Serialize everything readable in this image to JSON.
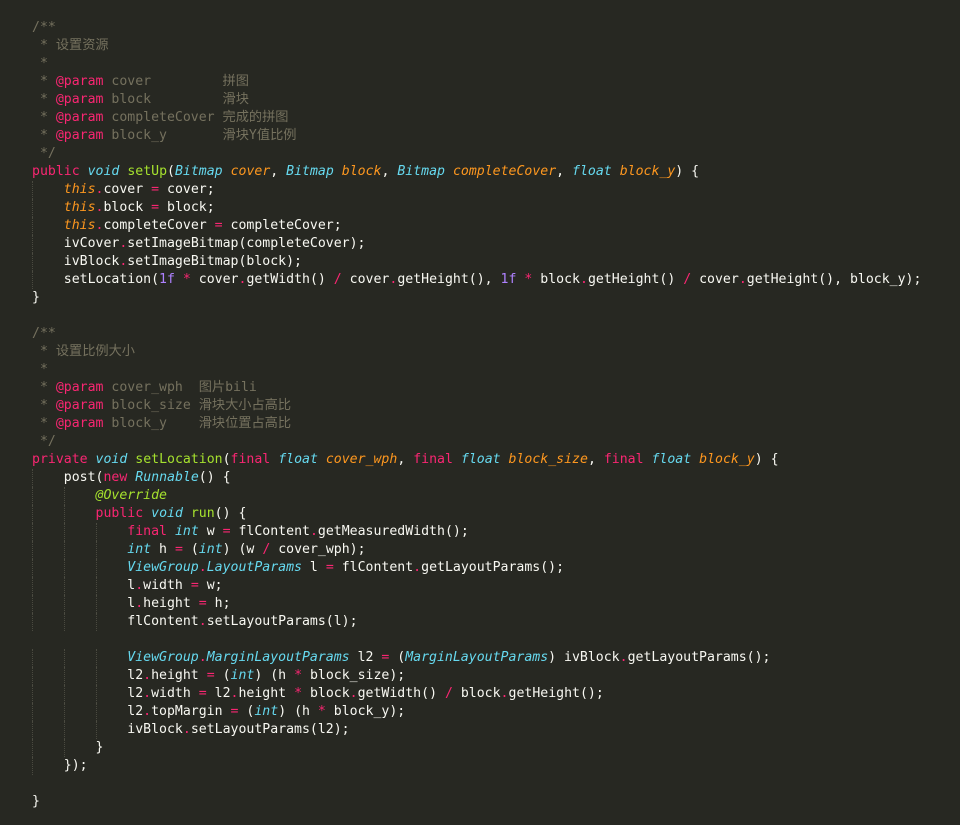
{
  "editor": {
    "theme_colors": {
      "background": "#272822",
      "comment": "#75715e",
      "keyword": "#f92672",
      "type": "#66d9ef",
      "function": "#a6e22e",
      "parameter": "#fd971f",
      "number": "#ae81ff",
      "text": "#f8f8f2"
    },
    "lines": [
      [
        {
          "t": "/**",
          "c": "comment"
        }
      ],
      [
        {
          "t": " * 设置资源",
          "c": "comment"
        }
      ],
      [
        {
          "t": " *",
          "c": "comment"
        }
      ],
      [
        {
          "t": " * ",
          "c": "comment"
        },
        {
          "t": "@param",
          "c": "tag"
        },
        {
          "t": " cover         拼图",
          "c": "comment"
        }
      ],
      [
        {
          "t": " * ",
          "c": "comment"
        },
        {
          "t": "@param",
          "c": "tag"
        },
        {
          "t": " block         滑块",
          "c": "comment"
        }
      ],
      [
        {
          "t": " * ",
          "c": "comment"
        },
        {
          "t": "@param",
          "c": "tag"
        },
        {
          "t": " completeCover 完成的拼图",
          "c": "comment"
        }
      ],
      [
        {
          "t": " * ",
          "c": "comment"
        },
        {
          "t": "@param",
          "c": "tag"
        },
        {
          "t": " block_y       滑块Y值比例",
          "c": "comment"
        }
      ],
      [
        {
          "t": " */",
          "c": "comment"
        }
      ],
      [
        {
          "t": "public",
          "c": "kw"
        },
        {
          "t": " ",
          "c": "plain"
        },
        {
          "t": "void",
          "c": "type"
        },
        {
          "t": " ",
          "c": "plain"
        },
        {
          "t": "setUp",
          "c": "fn"
        },
        {
          "t": "(",
          "c": "plain"
        },
        {
          "t": "Bitmap",
          "c": "type"
        },
        {
          "t": " ",
          "c": "plain"
        },
        {
          "t": "cover",
          "c": "param"
        },
        {
          "t": ", ",
          "c": "plain"
        },
        {
          "t": "Bitmap",
          "c": "type"
        },
        {
          "t": " ",
          "c": "plain"
        },
        {
          "t": "block",
          "c": "param"
        },
        {
          "t": ", ",
          "c": "plain"
        },
        {
          "t": "Bitmap",
          "c": "type"
        },
        {
          "t": " ",
          "c": "plain"
        },
        {
          "t": "completeCover",
          "c": "param"
        },
        {
          "t": ", ",
          "c": "plain"
        },
        {
          "t": "float",
          "c": "type"
        },
        {
          "t": " ",
          "c": "plain"
        },
        {
          "t": "block_y",
          "c": "param"
        },
        {
          "t": ") {",
          "c": "plain"
        }
      ],
      [
        {
          "t": "    ",
          "c": "plain"
        },
        {
          "t": "this",
          "c": "this"
        },
        {
          "t": ".",
          "c": "op"
        },
        {
          "t": "cover ",
          "c": "plain"
        },
        {
          "t": "=",
          "c": "op"
        },
        {
          "t": " cover;",
          "c": "plain"
        }
      ],
      [
        {
          "t": "    ",
          "c": "plain"
        },
        {
          "t": "this",
          "c": "this"
        },
        {
          "t": ".",
          "c": "op"
        },
        {
          "t": "block ",
          "c": "plain"
        },
        {
          "t": "=",
          "c": "op"
        },
        {
          "t": " block;",
          "c": "plain"
        }
      ],
      [
        {
          "t": "    ",
          "c": "plain"
        },
        {
          "t": "this",
          "c": "this"
        },
        {
          "t": ".",
          "c": "op"
        },
        {
          "t": "completeCover ",
          "c": "plain"
        },
        {
          "t": "=",
          "c": "op"
        },
        {
          "t": " completeCover;",
          "c": "plain"
        }
      ],
      [
        {
          "t": "    ivCover",
          "c": "plain"
        },
        {
          "t": ".",
          "c": "op"
        },
        {
          "t": "setImageBitmap(completeCover);",
          "c": "plain"
        }
      ],
      [
        {
          "t": "    ivBlock",
          "c": "plain"
        },
        {
          "t": ".",
          "c": "op"
        },
        {
          "t": "setImageBitmap(block);",
          "c": "plain"
        }
      ],
      [
        {
          "t": "    setLocation(",
          "c": "plain"
        },
        {
          "t": "1f",
          "c": "num"
        },
        {
          "t": " ",
          "c": "plain"
        },
        {
          "t": "*",
          "c": "op"
        },
        {
          "t": " cover",
          "c": "plain"
        },
        {
          "t": ".",
          "c": "op"
        },
        {
          "t": "getWidth() ",
          "c": "plain"
        },
        {
          "t": "/",
          "c": "op"
        },
        {
          "t": " cover",
          "c": "plain"
        },
        {
          "t": ".",
          "c": "op"
        },
        {
          "t": "getHeight(), ",
          "c": "plain"
        },
        {
          "t": "1f",
          "c": "num"
        },
        {
          "t": " ",
          "c": "plain"
        },
        {
          "t": "*",
          "c": "op"
        },
        {
          "t": " block",
          "c": "plain"
        },
        {
          "t": ".",
          "c": "op"
        },
        {
          "t": "getHeight() ",
          "c": "plain"
        },
        {
          "t": "/",
          "c": "op"
        },
        {
          "t": " cover",
          "c": "plain"
        },
        {
          "t": ".",
          "c": "op"
        },
        {
          "t": "getHeight(), block_y);",
          "c": "plain"
        }
      ],
      [
        {
          "t": "}",
          "c": "plain"
        }
      ],
      [],
      [
        {
          "t": "/**",
          "c": "comment"
        }
      ],
      [
        {
          "t": " * 设置比例大小",
          "c": "comment"
        }
      ],
      [
        {
          "t": " *",
          "c": "comment"
        }
      ],
      [
        {
          "t": " * ",
          "c": "comment"
        },
        {
          "t": "@param",
          "c": "tag"
        },
        {
          "t": " cover_wph  图片bili",
          "c": "comment"
        }
      ],
      [
        {
          "t": " * ",
          "c": "comment"
        },
        {
          "t": "@param",
          "c": "tag"
        },
        {
          "t": " block_size 滑块大小占高比",
          "c": "comment"
        }
      ],
      [
        {
          "t": " * ",
          "c": "comment"
        },
        {
          "t": "@param",
          "c": "tag"
        },
        {
          "t": " block_y    滑块位置占高比",
          "c": "comment"
        }
      ],
      [
        {
          "t": " */",
          "c": "comment"
        }
      ],
      [
        {
          "t": "private",
          "c": "kw"
        },
        {
          "t": " ",
          "c": "plain"
        },
        {
          "t": "void",
          "c": "type"
        },
        {
          "t": " ",
          "c": "plain"
        },
        {
          "t": "setLocation",
          "c": "fn"
        },
        {
          "t": "(",
          "c": "plain"
        },
        {
          "t": "final",
          "c": "kw"
        },
        {
          "t": " ",
          "c": "plain"
        },
        {
          "t": "float",
          "c": "type"
        },
        {
          "t": " ",
          "c": "plain"
        },
        {
          "t": "cover_wph",
          "c": "param"
        },
        {
          "t": ", ",
          "c": "plain"
        },
        {
          "t": "final",
          "c": "kw"
        },
        {
          "t": " ",
          "c": "plain"
        },
        {
          "t": "float",
          "c": "type"
        },
        {
          "t": " ",
          "c": "plain"
        },
        {
          "t": "block_size",
          "c": "param"
        },
        {
          "t": ", ",
          "c": "plain"
        },
        {
          "t": "final",
          "c": "kw"
        },
        {
          "t": " ",
          "c": "plain"
        },
        {
          "t": "float",
          "c": "type"
        },
        {
          "t": " ",
          "c": "plain"
        },
        {
          "t": "block_y",
          "c": "param"
        },
        {
          "t": ") {",
          "c": "plain"
        }
      ],
      [
        {
          "t": "    post(",
          "c": "plain"
        },
        {
          "t": "new",
          "c": "kw"
        },
        {
          "t": " ",
          "c": "plain"
        },
        {
          "t": "Runnable",
          "c": "type"
        },
        {
          "t": "() {",
          "c": "plain"
        }
      ],
      [
        {
          "t": "        ",
          "c": "plain"
        },
        {
          "t": "@Override",
          "c": "annot"
        }
      ],
      [
        {
          "t": "        ",
          "c": "plain"
        },
        {
          "t": "public",
          "c": "kw"
        },
        {
          "t": " ",
          "c": "plain"
        },
        {
          "t": "void",
          "c": "type"
        },
        {
          "t": " ",
          "c": "plain"
        },
        {
          "t": "run",
          "c": "fn"
        },
        {
          "t": "() {",
          "c": "plain"
        }
      ],
      [
        {
          "t": "            ",
          "c": "plain"
        },
        {
          "t": "final",
          "c": "kw"
        },
        {
          "t": " ",
          "c": "plain"
        },
        {
          "t": "int",
          "c": "prim"
        },
        {
          "t": " w ",
          "c": "plain"
        },
        {
          "t": "=",
          "c": "op"
        },
        {
          "t": " flContent",
          "c": "plain"
        },
        {
          "t": ".",
          "c": "op"
        },
        {
          "t": "getMeasuredWidth();",
          "c": "plain"
        }
      ],
      [
        {
          "t": "            ",
          "c": "plain"
        },
        {
          "t": "int",
          "c": "prim"
        },
        {
          "t": " h ",
          "c": "plain"
        },
        {
          "t": "=",
          "c": "op"
        },
        {
          "t": " (",
          "c": "plain"
        },
        {
          "t": "int",
          "c": "prim"
        },
        {
          "t": ") (w ",
          "c": "plain"
        },
        {
          "t": "/",
          "c": "op"
        },
        {
          "t": " cover_wph);",
          "c": "plain"
        }
      ],
      [
        {
          "t": "            ",
          "c": "plain"
        },
        {
          "t": "ViewGroup",
          "c": "type"
        },
        {
          "t": ".",
          "c": "op"
        },
        {
          "t": "LayoutParams",
          "c": "type"
        },
        {
          "t": " l ",
          "c": "plain"
        },
        {
          "t": "=",
          "c": "op"
        },
        {
          "t": " flContent",
          "c": "plain"
        },
        {
          "t": ".",
          "c": "op"
        },
        {
          "t": "getLayoutParams();",
          "c": "plain"
        }
      ],
      [
        {
          "t": "            l",
          "c": "plain"
        },
        {
          "t": ".",
          "c": "op"
        },
        {
          "t": "width ",
          "c": "plain"
        },
        {
          "t": "=",
          "c": "op"
        },
        {
          "t": " w;",
          "c": "plain"
        }
      ],
      [
        {
          "t": "            l",
          "c": "plain"
        },
        {
          "t": ".",
          "c": "op"
        },
        {
          "t": "height ",
          "c": "plain"
        },
        {
          "t": "=",
          "c": "op"
        },
        {
          "t": " h;",
          "c": "plain"
        }
      ],
      [
        {
          "t": "            flContent",
          "c": "plain"
        },
        {
          "t": ".",
          "c": "op"
        },
        {
          "t": "setLayoutParams(l);",
          "c": "plain"
        }
      ],
      [],
      [
        {
          "t": "            ",
          "c": "plain"
        },
        {
          "t": "ViewGroup",
          "c": "type"
        },
        {
          "t": ".",
          "c": "op"
        },
        {
          "t": "MarginLayoutParams",
          "c": "type"
        },
        {
          "t": " l2 ",
          "c": "plain"
        },
        {
          "t": "=",
          "c": "op"
        },
        {
          "t": " (",
          "c": "plain"
        },
        {
          "t": "MarginLayoutParams",
          "c": "type"
        },
        {
          "t": ") ivBlock",
          "c": "plain"
        },
        {
          "t": ".",
          "c": "op"
        },
        {
          "t": "getLayoutParams();",
          "c": "plain"
        }
      ],
      [
        {
          "t": "            l2",
          "c": "plain"
        },
        {
          "t": ".",
          "c": "op"
        },
        {
          "t": "height ",
          "c": "plain"
        },
        {
          "t": "=",
          "c": "op"
        },
        {
          "t": " (",
          "c": "plain"
        },
        {
          "t": "int",
          "c": "prim"
        },
        {
          "t": ") (h ",
          "c": "plain"
        },
        {
          "t": "*",
          "c": "op"
        },
        {
          "t": " block_size);",
          "c": "plain"
        }
      ],
      [
        {
          "t": "            l2",
          "c": "plain"
        },
        {
          "t": ".",
          "c": "op"
        },
        {
          "t": "width ",
          "c": "plain"
        },
        {
          "t": "=",
          "c": "op"
        },
        {
          "t": " l2",
          "c": "plain"
        },
        {
          "t": ".",
          "c": "op"
        },
        {
          "t": "height ",
          "c": "plain"
        },
        {
          "t": "*",
          "c": "op"
        },
        {
          "t": " block",
          "c": "plain"
        },
        {
          "t": ".",
          "c": "op"
        },
        {
          "t": "getWidth() ",
          "c": "plain"
        },
        {
          "t": "/",
          "c": "op"
        },
        {
          "t": " block",
          "c": "plain"
        },
        {
          "t": ".",
          "c": "op"
        },
        {
          "t": "getHeight();",
          "c": "plain"
        }
      ],
      [
        {
          "t": "            l2",
          "c": "plain"
        },
        {
          "t": ".",
          "c": "op"
        },
        {
          "t": "topMargin ",
          "c": "plain"
        },
        {
          "t": "=",
          "c": "op"
        },
        {
          "t": " (",
          "c": "plain"
        },
        {
          "t": "int",
          "c": "prim"
        },
        {
          "t": ") (h ",
          "c": "plain"
        },
        {
          "t": "*",
          "c": "op"
        },
        {
          "t": " block_y);",
          "c": "plain"
        }
      ],
      [
        {
          "t": "            ivBlock",
          "c": "plain"
        },
        {
          "t": ".",
          "c": "op"
        },
        {
          "t": "setLayoutParams(l2);",
          "c": "plain"
        }
      ],
      [
        {
          "t": "        }",
          "c": "plain"
        }
      ],
      [
        {
          "t": "    });",
          "c": "plain"
        }
      ],
      [],
      [
        {
          "t": "}",
          "c": "plain"
        }
      ]
    ]
  }
}
